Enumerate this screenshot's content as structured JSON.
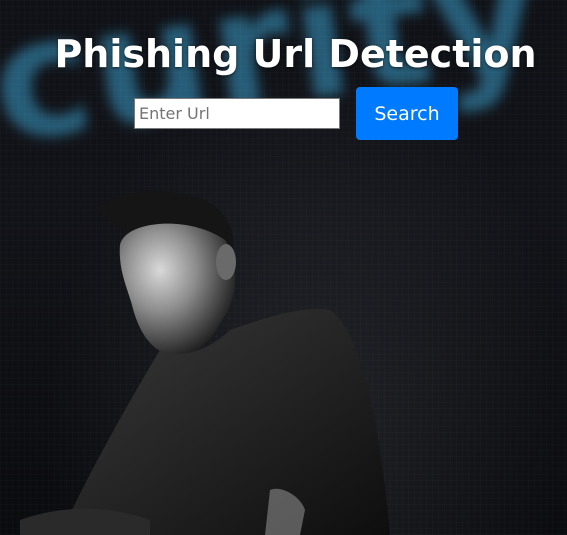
{
  "page": {
    "title": "Phishing Url Detection"
  },
  "search": {
    "placeholder": "Enter Url",
    "value": "",
    "button_label": "Search"
  },
  "background": {
    "description_word": "curity",
    "glow_color": "#399bc8"
  },
  "colors": {
    "button": "#007bff",
    "title": "#ffffff"
  }
}
